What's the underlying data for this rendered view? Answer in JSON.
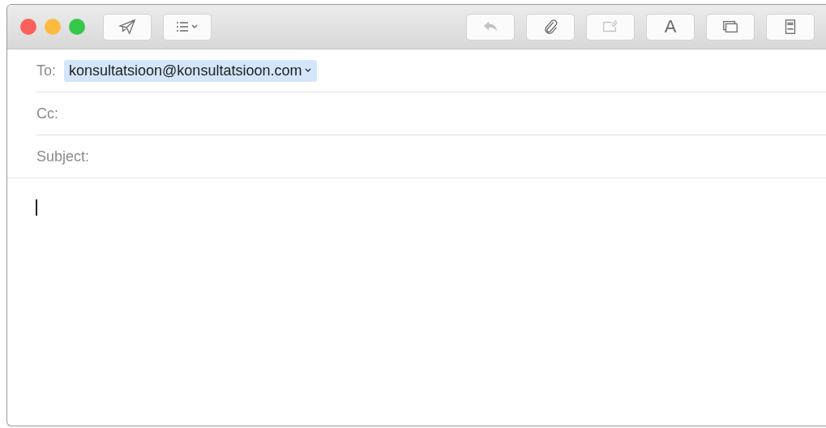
{
  "toolbar": {
    "left_buttons": [
      {
        "kind": "send",
        "disabled": false
      },
      {
        "kind": "format",
        "disabled": false
      }
    ],
    "right_buttons": [
      {
        "kind": "reply",
        "disabled": true
      },
      {
        "kind": "attach",
        "disabled": false
      },
      {
        "kind": "photo",
        "disabled": true
      },
      {
        "kind": "font",
        "label": "A",
        "disabled": false
      },
      {
        "kind": "window",
        "disabled": false
      },
      {
        "kind": "stationery",
        "disabled": false
      }
    ]
  },
  "fields": [
    {
      "label": "To:",
      "value": "konsultatsioon@konsultatsioon.com",
      "selected": true
    },
    {
      "label": "Cc:"
    },
    {
      "label": "Subject:"
    }
  ]
}
